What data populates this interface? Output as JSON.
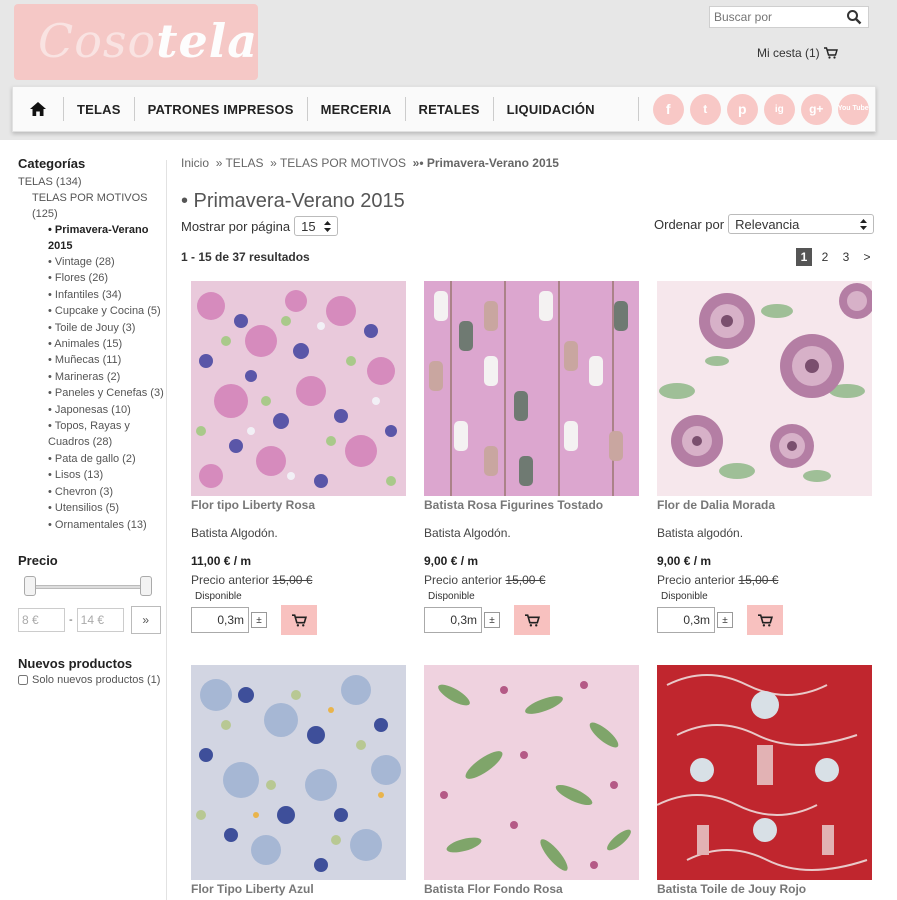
{
  "brand": {
    "logo_part1": "Coso",
    "logo_part2": "tela"
  },
  "header": {
    "search_placeholder": "Buscar por",
    "cart_label": "Mi cesta (1)"
  },
  "nav": {
    "items": [
      "TELAS",
      "PATRONES IMPRESOS",
      "MERCERIA",
      "RETALES",
      "LIQUIDACIÓN"
    ],
    "social": [
      "f",
      "t",
      "p",
      "ig",
      "g+",
      "You Tube"
    ]
  },
  "sidebar": {
    "categories_title": "Categorías",
    "telas": "TELAS (134)",
    "telas_por_motivos": "TELAS POR MOTIVOS (125)",
    "active": "• Primavera-Verano 2015",
    "subcategories": [
      "• Vintage (28)",
      "• Flores (26)",
      "• Infantiles (34)",
      "• Cupcake y Cocina (5)",
      "• Toile de Jouy (3)",
      "• Animales (15)",
      "• Muñecas (11)",
      "• Marineras (2)",
      "• Paneles y Cenefas (3)",
      "• Japonesas (10)",
      "• Topos, Rayas y Cuadros (28)",
      "• Pata de gallo (2)",
      "• Lisos (13)",
      "• Chevron (3)",
      "• Utensilios (5)",
      "• Ornamentales (13)"
    ],
    "price_title": "Precio",
    "price_min": "8 €",
    "price_max": "14 €",
    "price_go": "»",
    "new_title": "Nuevos productos",
    "new_only": "Solo nuevos productos (1)"
  },
  "main": {
    "breadcrumb": [
      "Inicio",
      "» TELAS",
      "» TELAS POR MOTIVOS",
      "»• Primavera-Verano 2015"
    ],
    "title": "• Primavera-Verano 2015",
    "per_page_label": "Mostrar por página",
    "per_page_value": "15",
    "sort_label": "Ordenar por",
    "sort_value": "Relevancia",
    "results": "1 - 15 de 37 resultados",
    "pages": [
      "1",
      "2",
      "3",
      ">"
    ]
  },
  "products": [
    {
      "name": "Flor tipo Liberty Rosa",
      "desc": "Batista Algodón.",
      "price": "11,00 € / m",
      "old_label": "Precio anterior",
      "old_price": "15,00 €",
      "stock": "Disponible",
      "qty": "0,3",
      "unit": "m"
    },
    {
      "name": "Batista Rosa Figurines Tostado",
      "desc": "Batista Algodón.",
      "price": "9,00 € / m",
      "old_label": "Precio anterior",
      "old_price": "15,00 €",
      "stock": "Disponible",
      "qty": "0,3",
      "unit": "m"
    },
    {
      "name": "Flor de Dalia Morada",
      "desc": "Batista algodón.",
      "price": "9,00 € / m",
      "old_label": "Precio anterior",
      "old_price": "15,00 €",
      "stock": "Disponible",
      "qty": "0,3",
      "unit": "m"
    },
    {
      "name": "Flor Tipo Liberty Azul"
    },
    {
      "name": "Batista Flor Fondo Rosa"
    },
    {
      "name": "Batista Toile de Jouy Rojo"
    }
  ],
  "colors": {
    "accent_pink": "#f8c1bf",
    "logo_pink": "#f6c7c5"
  }
}
